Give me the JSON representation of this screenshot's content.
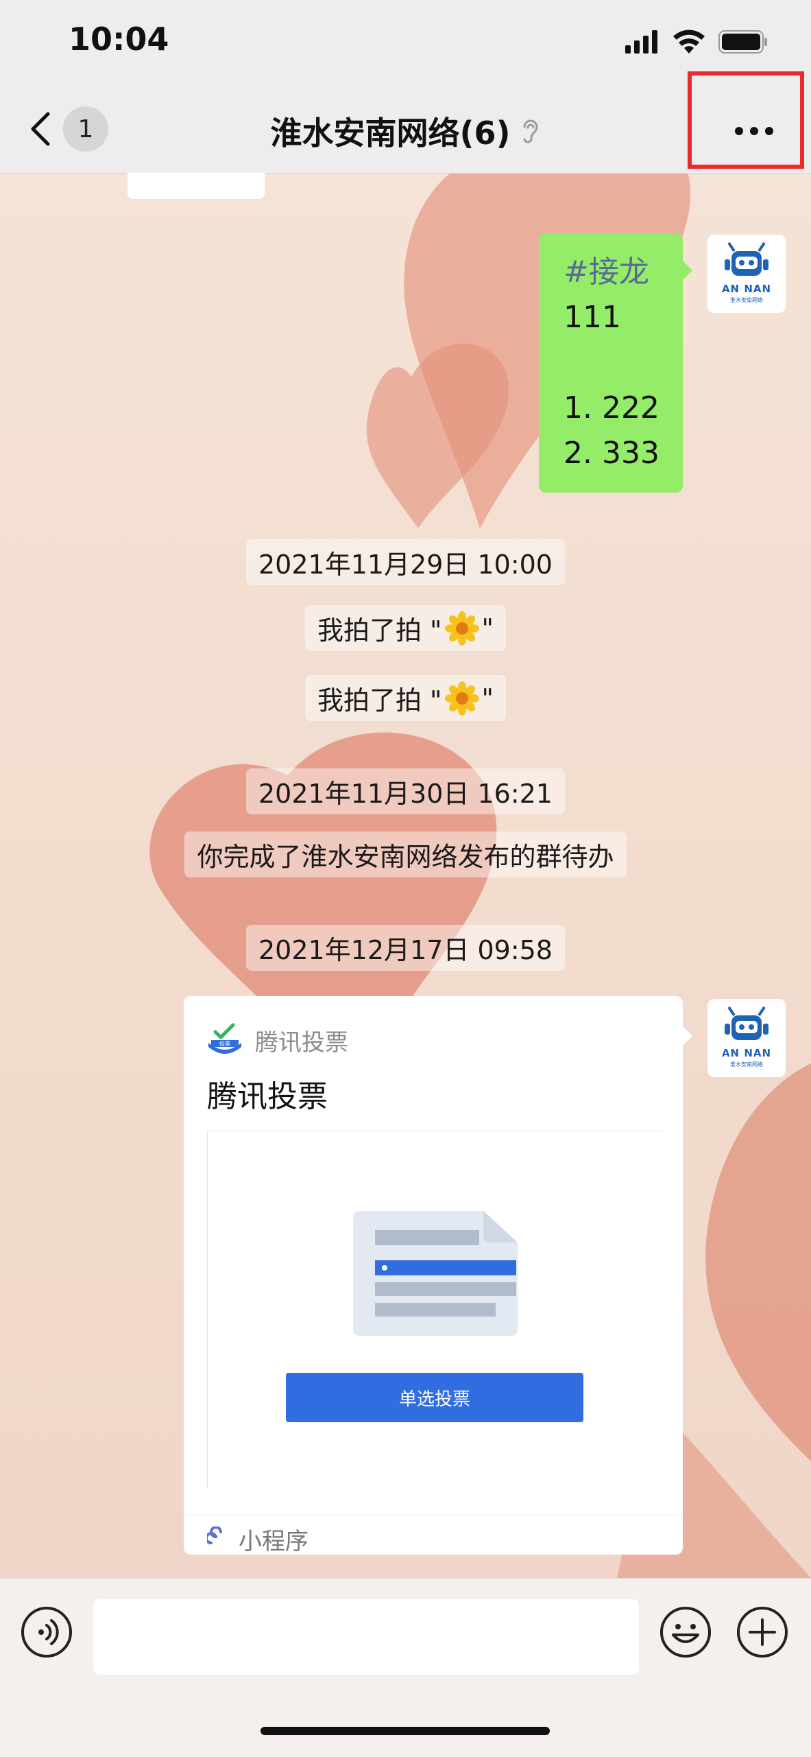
{
  "status_bar": {
    "time": "10:04"
  },
  "nav": {
    "unread_count": "1",
    "title": "淮水安南网络(6)"
  },
  "avatar": {
    "brand": "AN NAN",
    "subtitle": "淮水安南网络"
  },
  "messages": {
    "green_bubble_lines": [
      "#接龙",
      "111",
      "",
      "1. 222",
      "2. 333"
    ]
  },
  "system": {
    "ts1": "2021年11月29日 10:00",
    "pat1_prefix": "我拍了拍 \"",
    "pat1_suffix": "\"",
    "pat2_prefix": "我拍了拍 \"",
    "pat2_suffix": "\"",
    "ts2": "2021年11月30日 16:21",
    "todo": "你完成了淮水安南网络发布的群待办",
    "ts3": "2021年12月17日 09:58"
  },
  "card": {
    "app_name": "腾讯投票",
    "title": "腾讯投票",
    "button_label": "单选投票",
    "footer_label": "小程序",
    "logo_text": "投票"
  },
  "input": {
    "placeholder": ""
  },
  "colors": {
    "bubble_green": "#95ec69",
    "link_blue": "#2f6de1",
    "highlight_red": "#ec2a2a"
  }
}
